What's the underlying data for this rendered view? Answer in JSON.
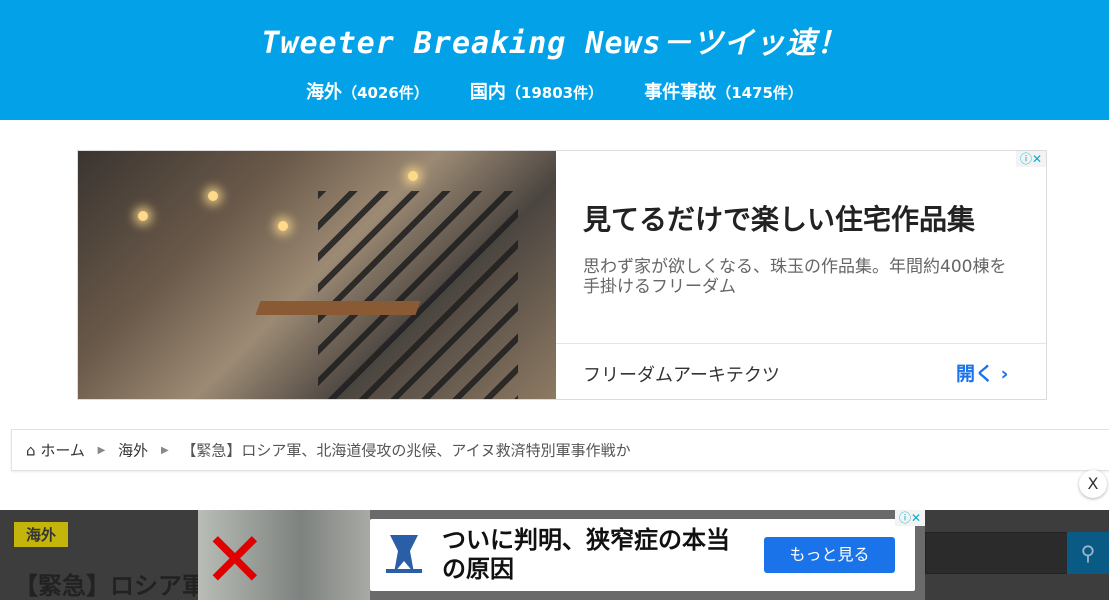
{
  "header": {
    "title": "Tweeter Breaking News－ツイッ速！",
    "nav": [
      {
        "label": "海外",
        "count": "（4026件）"
      },
      {
        "label": "国内",
        "count": "（19803件）"
      },
      {
        "label": "事件事故",
        "count": "（1475件）"
      }
    ],
    "bg_color": "#03a2e8"
  },
  "ad": {
    "headline": "見てるだけで楽しい住宅作品集",
    "description": "思わず家が欲しくなる、珠玉の作品集。年間約400棟を手掛けるフリーダム",
    "advertiser": "フリーダムアーキテクツ",
    "open_label": "開く",
    "adchoices": "ⓘ✕"
  },
  "breadcrumb": {
    "home": "ホーム",
    "category": "海外",
    "current": "【緊急】ロシア軍、北海道侵攻の兆候、アイヌ救済特別軍事作戦か"
  },
  "close_label": "X",
  "article": {
    "category": "海外",
    "title": "【緊急】ロシア軍"
  },
  "bottom_ad": {
    "headline": "ついに判明、狭窄症の本当の原因",
    "cta": "もっと見る",
    "adchoices": "ⓘ✕"
  }
}
